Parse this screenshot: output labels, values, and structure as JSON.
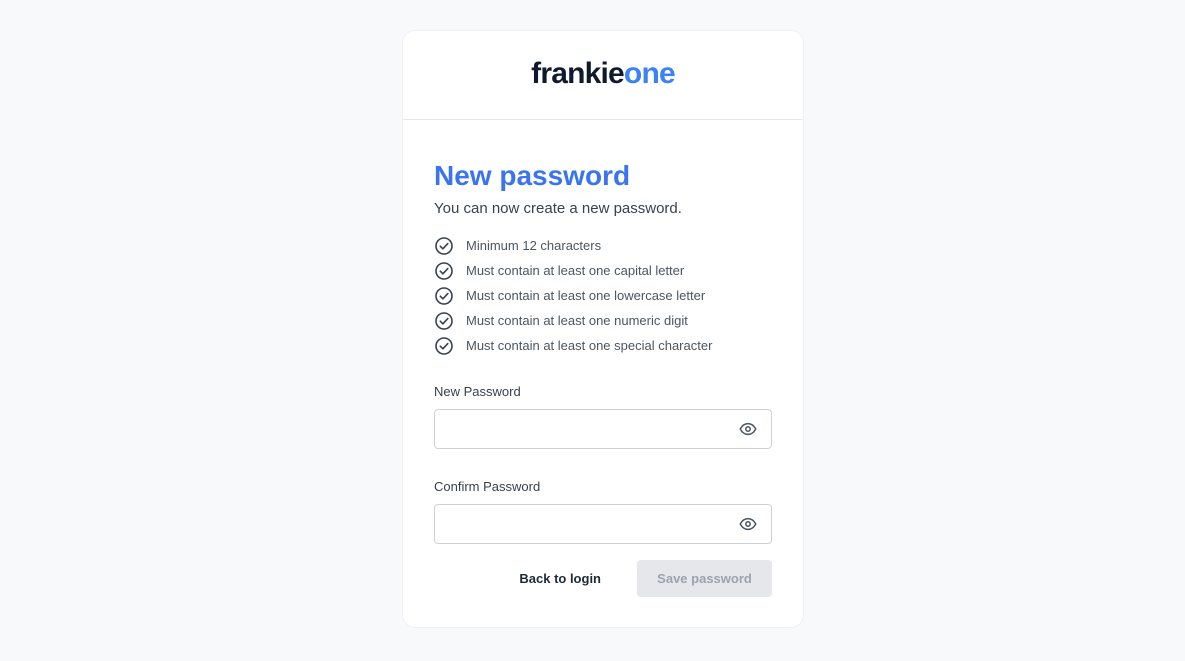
{
  "logo": {
    "part1": "frankie",
    "part2": "one"
  },
  "form": {
    "title": "New password",
    "subtitle": "You can now create a new password.",
    "rules": [
      "Minimum 12 characters",
      "Must contain at least one capital letter",
      "Must contain at least one lowercase letter",
      "Must contain at least one numeric digit",
      "Must contain at least one special character"
    ],
    "new_password": {
      "label": "New Password",
      "value": "",
      "placeholder": ""
    },
    "confirm_password": {
      "label": "Confirm Password",
      "value": "",
      "placeholder": ""
    },
    "back_label": "Back to login",
    "save_label": "Save password"
  },
  "icons": {
    "rule": "check-circle-icon",
    "toggle": "eye-icon"
  },
  "colors": {
    "accent": "#3b74f0",
    "logo_dark": "#0f1b2d",
    "logo_blue": "#3b82f6",
    "disabled_bg": "#e5e7eb",
    "disabled_text": "#9ca3af",
    "page_bg": "#f7f9fb"
  }
}
